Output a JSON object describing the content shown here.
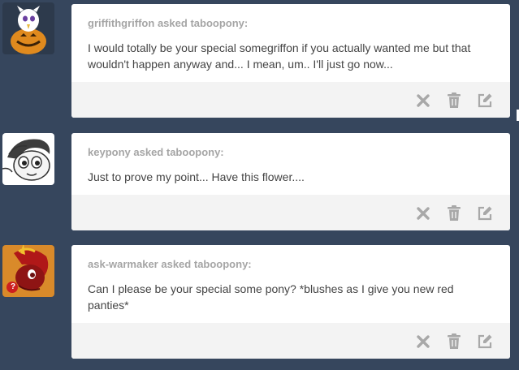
{
  "posts": [
    {
      "asker": "griffithgriffon",
      "asked_text": "asked",
      "recipient": "taboopony:",
      "question": "I would totally be your special somegriffon if you actually wanted me but that wouldn't happen anyway and... I mean, um.. I'll just go now...",
      "avatar_icon": "griffon-pumpkin-avatar"
    },
    {
      "asker": "keypony",
      "asked_text": "asked",
      "recipient": "taboopony:",
      "question": "Just to prove my point... Have this flower....",
      "avatar_icon": "grey-pony-avatar"
    },
    {
      "asker": "ask-warmaker",
      "asked_text": "asked",
      "recipient": "taboopony:",
      "question": "Can I please be your special some pony? *blushes as I give you new red panties*",
      "avatar_icon": "red-pony-avatar",
      "avatar_badge": "?"
    }
  ],
  "actions": {
    "delete_icon": "x-icon",
    "trash_icon": "trash-icon",
    "edit_icon": "edit-icon"
  },
  "colors": {
    "background": "#36465d",
    "card": "#ffffff",
    "footer": "#f3f3f3",
    "asker_text": "#a5a5a5",
    "body_text": "#444444",
    "icon": "#a8a8a8"
  }
}
